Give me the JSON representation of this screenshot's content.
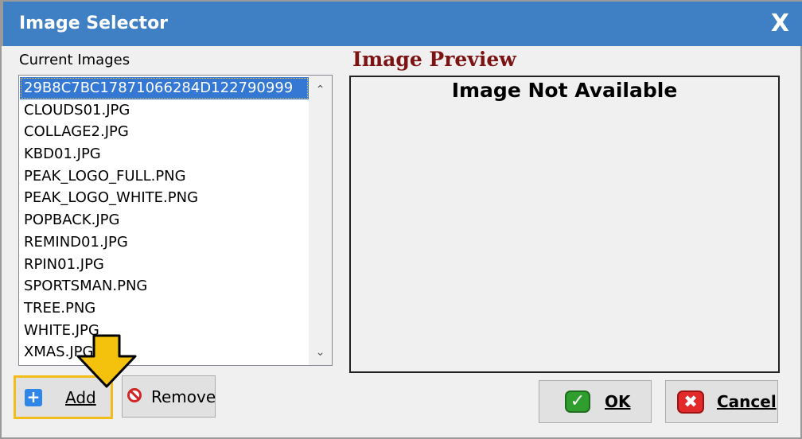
{
  "window": {
    "title": "Image Selector",
    "close_glyph": "X"
  },
  "images_panel": {
    "label": "Current Images",
    "selected_index": 0,
    "items": [
      "29B8C7BC17871066284D122790999",
      "CLOUDS01.JPG",
      "COLLAGE2.JPG",
      "KBD01.JPG",
      "PEAK_LOGO_FULL.PNG",
      "PEAK_LOGO_WHITE.PNG",
      "POPBACK.JPG",
      "REMIND01.JPG",
      "RPIN01.JPG",
      "SPORTSMAN.PNG",
      "TREE.PNG",
      "WHITE.JPG",
      "XMAS.JPG"
    ]
  },
  "preview": {
    "title": "Image Preview",
    "message": "Image Not Available"
  },
  "buttons": {
    "add": {
      "label": "Add",
      "icon": "plus-icon"
    },
    "remove": {
      "label": "Remove",
      "icon": "no-entry-icon"
    },
    "ok": {
      "label": "OK",
      "icon": "check-icon"
    },
    "cancel": {
      "label": "Cancel",
      "icon": "x-icon"
    }
  },
  "colors": {
    "titlebar": "#3f7fc4",
    "selection": "#3478d3",
    "preview_title": "#7c1212",
    "highlight": "#f2bd19"
  }
}
